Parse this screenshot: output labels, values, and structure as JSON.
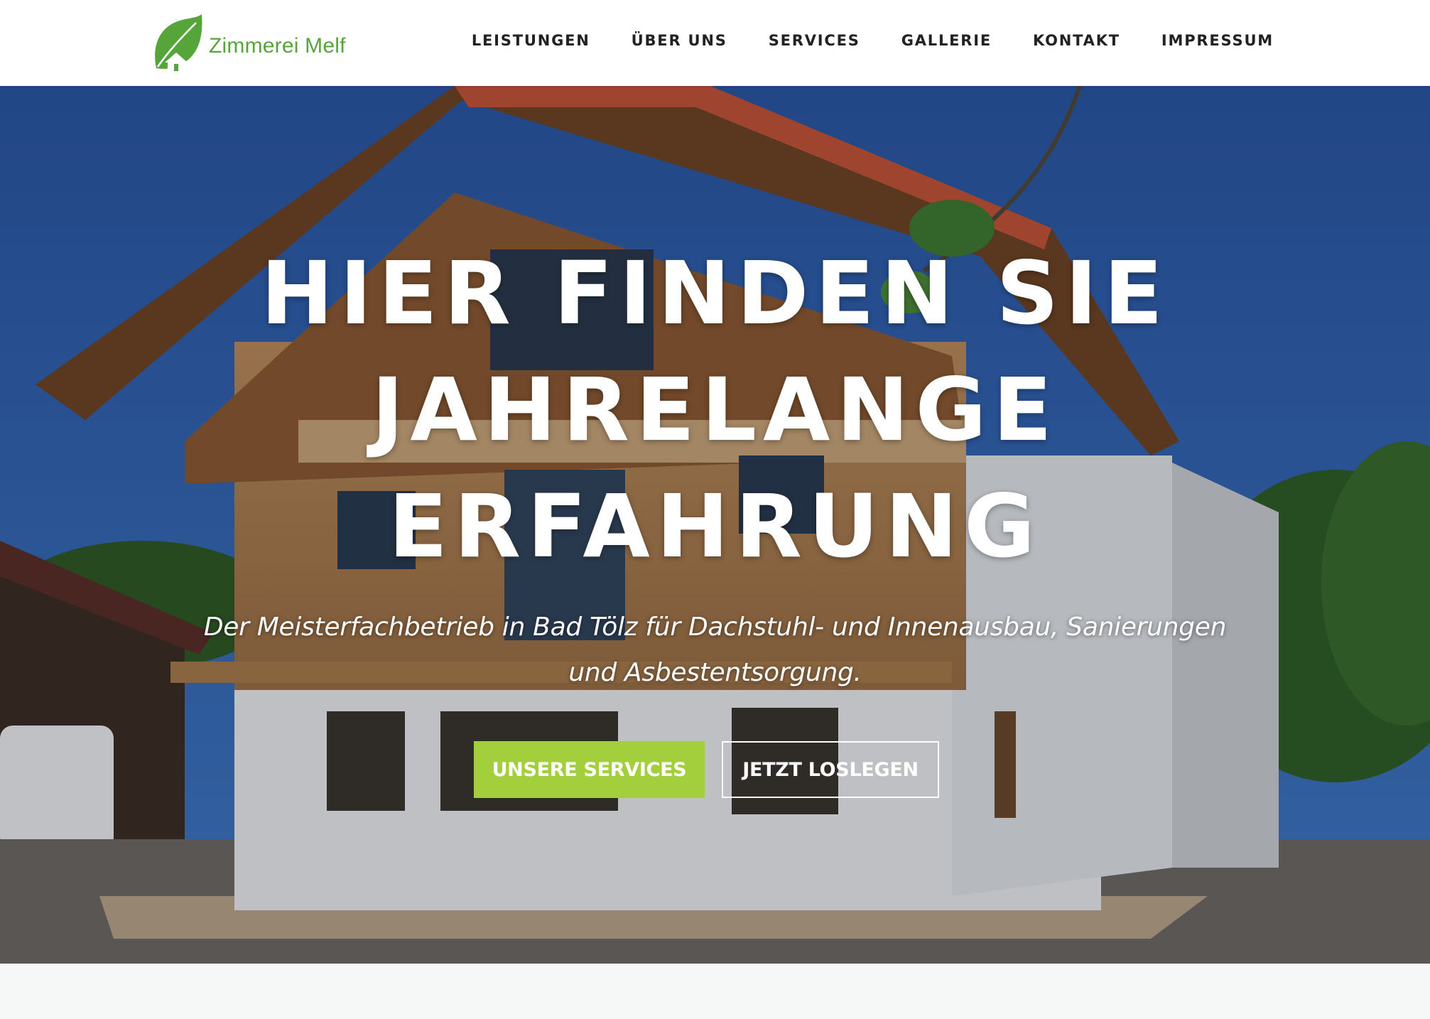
{
  "brand": {
    "name": "Zimmerei Melf",
    "accent_color": "#56a53a",
    "icon": "leaf-house-icon"
  },
  "nav": {
    "items": [
      {
        "label": "LEISTUNGEN"
      },
      {
        "label": "ÜBER UNS"
      },
      {
        "label": "SERVICES"
      },
      {
        "label": "GALLERIE"
      },
      {
        "label": "KONTAKT"
      },
      {
        "label": "IMPRESSUM"
      }
    ]
  },
  "hero": {
    "title_lines": [
      "HIER FINDEN SIE",
      "JAHRELANGE",
      "ERFAHRUNG"
    ],
    "subtitle": "Der Meisterfachbetrieb in Bad Tölz für Dachstuhl- und Innenausbau, Sanierungen und Asbestentsorgung.",
    "primary_button": "UNSERE SERVICES",
    "secondary_button": "JETZT LOSLEGEN",
    "primary_color": "#a4cf3c"
  }
}
